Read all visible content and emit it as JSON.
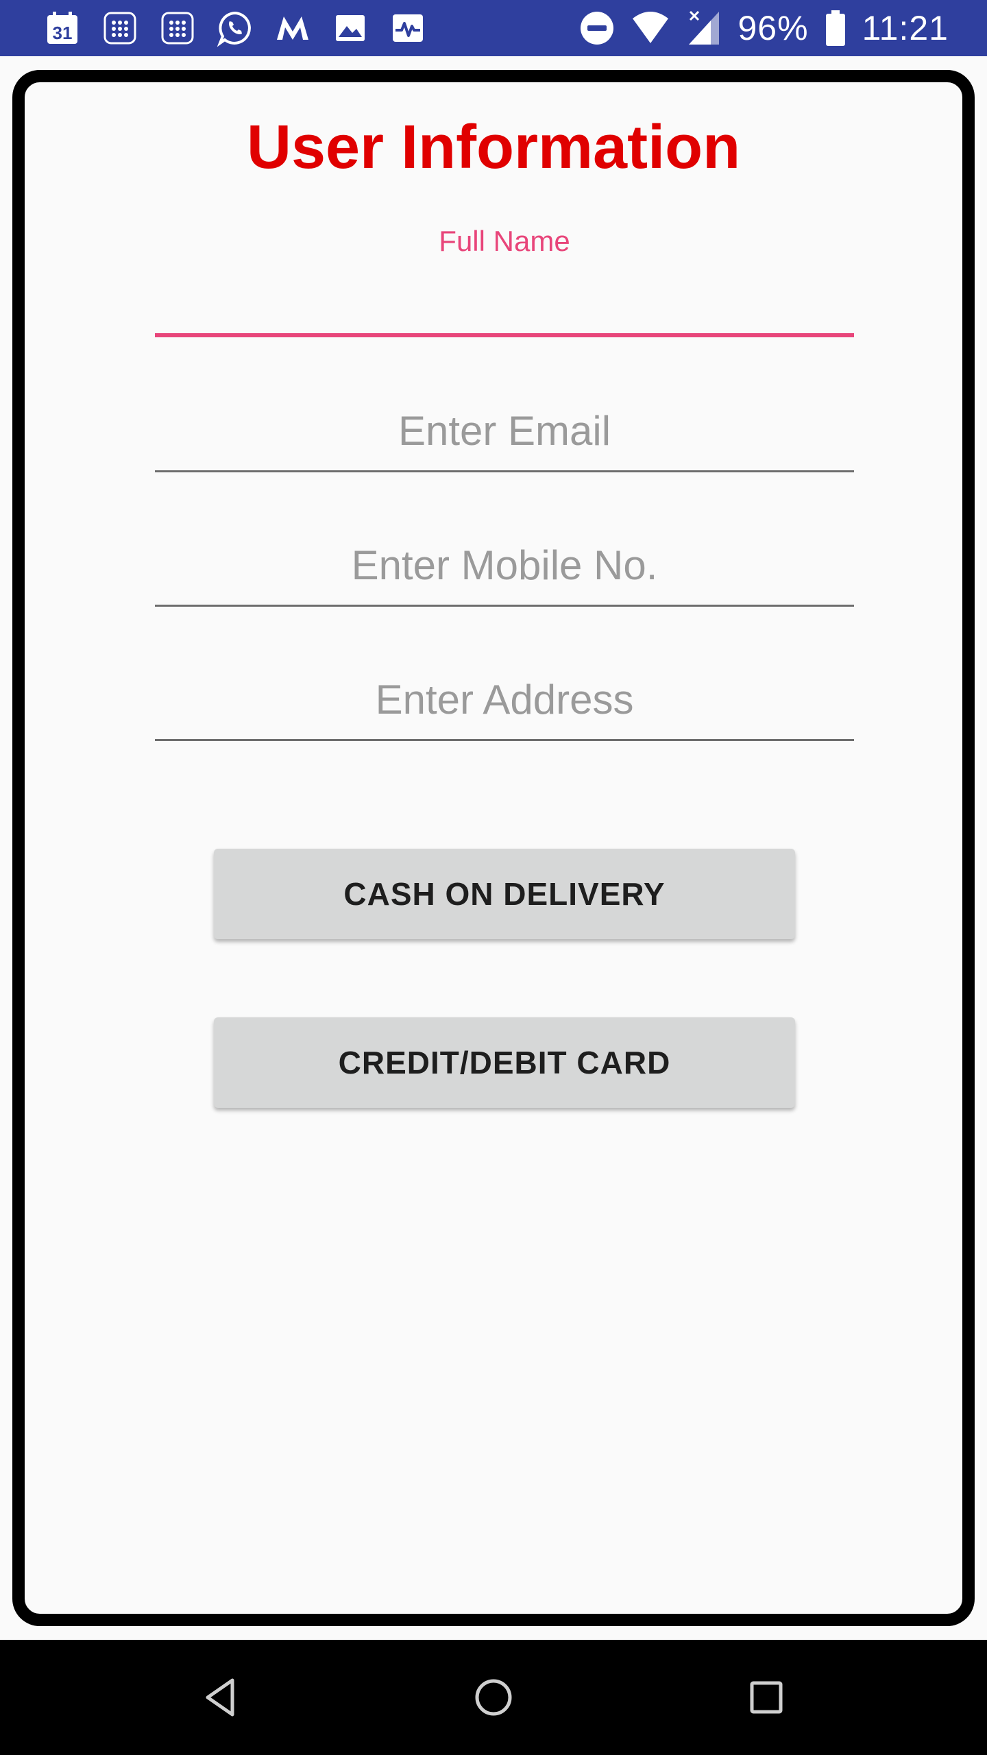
{
  "status_bar": {
    "left_icons": [
      "calendar-icon",
      "grid-app-icon",
      "grid-app-icon",
      "whatsapp-icon",
      "myntra-icon",
      "gallery-icon",
      "activity-monitor-icon"
    ],
    "calendar_day": "31",
    "battery_percent": "96%",
    "time": "11:21",
    "background_color": "#2f3f9e"
  },
  "form": {
    "title": "User Information",
    "title_color": "#e00000",
    "full_name": {
      "label": "Full Name",
      "value": "",
      "accent_color": "#e8457a"
    },
    "email": {
      "placeholder": "Enter Email",
      "value": ""
    },
    "mobile": {
      "placeholder": "Enter Mobile No.",
      "value": ""
    },
    "address": {
      "placeholder": "Enter Address",
      "value": ""
    },
    "buttons": {
      "cash_on_delivery": "CASH ON DELIVERY",
      "credit_debit_card": "CREDIT/DEBIT CARD"
    }
  },
  "nav_bar": {
    "icons": [
      "back-icon",
      "home-icon",
      "recents-icon"
    ]
  }
}
